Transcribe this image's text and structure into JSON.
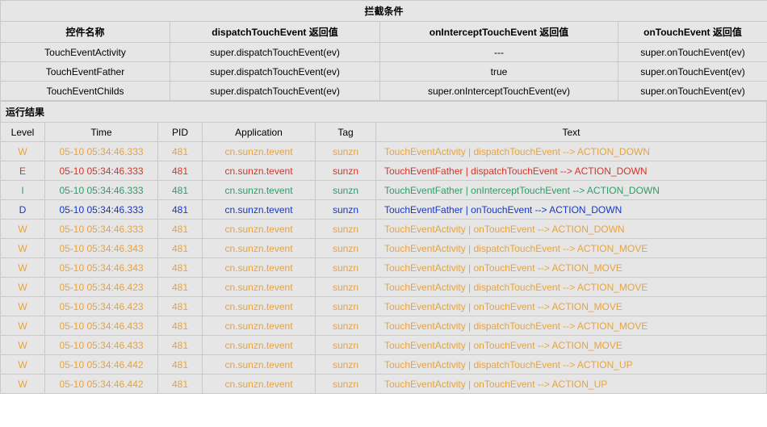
{
  "top": {
    "title": "拦截条件",
    "headers": [
      "控件名称",
      "dispatchTouchEvent 返回值",
      "onInterceptTouchEvent 返回值",
      "onTouchEvent 返回值"
    ],
    "rows": [
      [
        "TouchEventActivity",
        "super.dispatchTouchEvent(ev)",
        "---",
        "super.onTouchEvent(ev)"
      ],
      [
        "TouchEventFather",
        "super.dispatchTouchEvent(ev)",
        "true",
        "super.onTouchEvent(ev)"
      ],
      [
        "TouchEventChilds",
        "super.dispatchTouchEvent(ev)",
        "super.onInterceptTouchEvent(ev)",
        "super.onTouchEvent(ev)"
      ]
    ]
  },
  "section_label": "运行结果",
  "log": {
    "headers": [
      "Level",
      "Time",
      "PID",
      "Application",
      "Tag",
      "Text"
    ],
    "rows": [
      {
        "level": "W",
        "time": "05-10 05:34:46.333",
        "pid": "481",
        "app": "cn.sunzn.tevent",
        "tag": "sunzn",
        "text": "TouchEventActivity | dispatchTouchEvent --> ACTION_DOWN"
      },
      {
        "level": "E",
        "time": "05-10 05:34:46.333",
        "pid": "481",
        "app": "cn.sunzn.tevent",
        "tag": "sunzn",
        "text": "TouchEventFather | dispatchTouchEvent --> ACTION_DOWN"
      },
      {
        "level": "I",
        "time": "05-10 05:34:46.333",
        "pid": "481",
        "app": "cn.sunzn.tevent",
        "tag": "sunzn",
        "text": "TouchEventFather | onInterceptTouchEvent --> ACTION_DOWN"
      },
      {
        "level": "D",
        "time": "05-10 05:34:46.333",
        "pid": "481",
        "app": "cn.sunzn.tevent",
        "tag": "sunzn",
        "text": "TouchEventFather | onTouchEvent --> ACTION_DOWN"
      },
      {
        "level": "W",
        "time": "05-10 05:34:46.333",
        "pid": "481",
        "app": "cn.sunzn.tevent",
        "tag": "sunzn",
        "text": "TouchEventActivity | onTouchEvent --> ACTION_DOWN"
      },
      {
        "level": "W",
        "time": "05-10 05:34:46.343",
        "pid": "481",
        "app": "cn.sunzn.tevent",
        "tag": "sunzn",
        "text": "TouchEventActivity | dispatchTouchEvent --> ACTION_MOVE"
      },
      {
        "level": "W",
        "time": "05-10 05:34:46.343",
        "pid": "481",
        "app": "cn.sunzn.tevent",
        "tag": "sunzn",
        "text": "TouchEventActivity | onTouchEvent --> ACTION_MOVE"
      },
      {
        "level": "W",
        "time": "05-10 05:34:46.423",
        "pid": "481",
        "app": "cn.sunzn.tevent",
        "tag": "sunzn",
        "text": "TouchEventActivity | dispatchTouchEvent --> ACTION_MOVE"
      },
      {
        "level": "W",
        "time": "05-10 05:34:46.423",
        "pid": "481",
        "app": "cn.sunzn.tevent",
        "tag": "sunzn",
        "text": "TouchEventActivity | onTouchEvent --> ACTION_MOVE"
      },
      {
        "level": "W",
        "time": "05-10 05:34:46.433",
        "pid": "481",
        "app": "cn.sunzn.tevent",
        "tag": "sunzn",
        "text": "TouchEventActivity | dispatchTouchEvent --> ACTION_MOVE"
      },
      {
        "level": "W",
        "time": "05-10 05:34:46.433",
        "pid": "481",
        "app": "cn.sunzn.tevent",
        "tag": "sunzn",
        "text": "TouchEventActivity | onTouchEvent --> ACTION_MOVE"
      },
      {
        "level": "W",
        "time": "05-10 05:34:46.442",
        "pid": "481",
        "app": "cn.sunzn.tevent",
        "tag": "sunzn",
        "text": "TouchEventActivity | dispatchTouchEvent --> ACTION_UP"
      },
      {
        "level": "W",
        "time": "05-10 05:34:46.442",
        "pid": "481",
        "app": "cn.sunzn.tevent",
        "tag": "sunzn",
        "text": "TouchEventActivity | onTouchEvent --> ACTION_UP"
      }
    ]
  }
}
